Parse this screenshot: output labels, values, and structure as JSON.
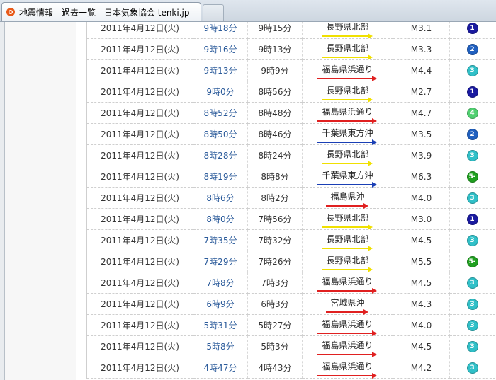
{
  "browser": {
    "tab_title": "地震情報 - 過去一覧 - 日本気象協会 tenki.jp"
  },
  "colors": {
    "blue": "#1a3fb5",
    "red": "#e02020",
    "yellow": "#f0e000",
    "int1": "#1a1aa0",
    "int2": "#2060c0",
    "int3": "#30c0c8",
    "int4": "#50d070",
    "int5m": "#20a020"
  },
  "rows": [
    {
      "date": "2011年4月12日(火)",
      "time": "9時18分",
      "occurred": "9時15分",
      "location": "長野県北部",
      "arrow": "#f0e000",
      "magnitude": "M3.1",
      "intensity": "1",
      "int_color": "#1a1aa0"
    },
    {
      "date": "2011年4月12日(火)",
      "time": "9時16分",
      "occurred": "9時13分",
      "location": "長野県北部",
      "arrow": "#f0e000",
      "magnitude": "M3.3",
      "intensity": "2",
      "int_color": "#2060c0"
    },
    {
      "date": "2011年4月12日(火)",
      "time": "9時13分",
      "occurred": "9時9分",
      "location": "福島県浜通り",
      "arrow": "#e02020",
      "magnitude": "M4.4",
      "intensity": "3",
      "int_color": "#30c0c8"
    },
    {
      "date": "2011年4月12日(火)",
      "time": "9時0分",
      "occurred": "8時56分",
      "location": "長野県北部",
      "arrow": "#f0e000",
      "magnitude": "M2.7",
      "intensity": "1",
      "int_color": "#1a1aa0"
    },
    {
      "date": "2011年4月12日(火)",
      "time": "8時52分",
      "occurred": "8時48分",
      "location": "福島県浜通り",
      "arrow": "#e02020",
      "magnitude": "M4.7",
      "intensity": "4",
      "int_color": "#50d070"
    },
    {
      "date": "2011年4月12日(火)",
      "time": "8時50分",
      "occurred": "8時46分",
      "location": "千葉県東方沖",
      "arrow": "#1a3fb5",
      "magnitude": "M3.5",
      "intensity": "2",
      "int_color": "#2060c0"
    },
    {
      "date": "2011年4月12日(火)",
      "time": "8時28分",
      "occurred": "8時24分",
      "location": "長野県北部",
      "arrow": "#f0e000",
      "magnitude": "M3.9",
      "intensity": "3",
      "int_color": "#30c0c8"
    },
    {
      "date": "2011年4月12日(火)",
      "time": "8時19分",
      "occurred": "8時8分",
      "location": "千葉県東方沖",
      "arrow": "#1a3fb5",
      "magnitude": "M6.3",
      "intensity": "5-",
      "int_color": "#20a020"
    },
    {
      "date": "2011年4月12日(火)",
      "time": "8時6分",
      "occurred": "8時2分",
      "location": "福島県沖",
      "arrow": "#e02020",
      "magnitude": "M4.0",
      "intensity": "3",
      "int_color": "#30c0c8"
    },
    {
      "date": "2011年4月12日(火)",
      "time": "8時0分",
      "occurred": "7時56分",
      "location": "長野県北部",
      "arrow": "#f0e000",
      "magnitude": "M3.0",
      "intensity": "1",
      "int_color": "#1a1aa0"
    },
    {
      "date": "2011年4月12日(火)",
      "time": "7時35分",
      "occurred": "7時32分",
      "location": "長野県北部",
      "arrow": "#f0e000",
      "magnitude": "M4.5",
      "intensity": "3",
      "int_color": "#30c0c8"
    },
    {
      "date": "2011年4月12日(火)",
      "time": "7時29分",
      "occurred": "7時26分",
      "location": "長野県北部",
      "arrow": "#f0e000",
      "magnitude": "M5.5",
      "intensity": "5-",
      "int_color": "#20a020"
    },
    {
      "date": "2011年4月12日(火)",
      "time": "7時8分",
      "occurred": "7時3分",
      "location": "福島県浜通り",
      "arrow": "#e02020",
      "magnitude": "M4.5",
      "intensity": "3",
      "int_color": "#30c0c8"
    },
    {
      "date": "2011年4月12日(火)",
      "time": "6時9分",
      "occurred": "6時3分",
      "location": "宮城県沖",
      "arrow": "#e02020",
      "magnitude": "M4.3",
      "intensity": "3",
      "int_color": "#30c0c8"
    },
    {
      "date": "2011年4月12日(火)",
      "time": "5時31分",
      "occurred": "5時27分",
      "location": "福島県浜通り",
      "arrow": "#e02020",
      "magnitude": "M4.0",
      "intensity": "3",
      "int_color": "#30c0c8"
    },
    {
      "date": "2011年4月12日(火)",
      "time": "5時8分",
      "occurred": "5時3分",
      "location": "福島県浜通り",
      "arrow": "#e02020",
      "magnitude": "M4.5",
      "intensity": "3",
      "int_color": "#30c0c8"
    },
    {
      "date": "2011年4月12日(火)",
      "time": "4時47分",
      "occurred": "4時43分",
      "location": "福島県浜通り",
      "arrow": "#e02020",
      "magnitude": "M4.2",
      "intensity": "3",
      "int_color": "#30c0c8"
    }
  ]
}
